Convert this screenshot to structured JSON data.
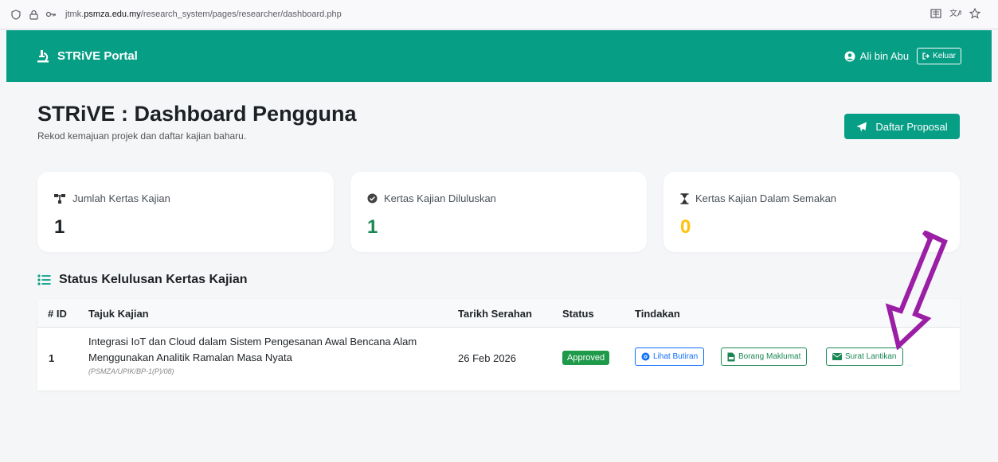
{
  "browser": {
    "url_prefix": "jtmk.",
    "url_domain": "psmza.edu.my",
    "url_path": "/research_system/pages/researcher/dashboard.php"
  },
  "navbar": {
    "brand": "STRiVE Portal",
    "user": "Ali bin Abu",
    "logout": "Keluar",
    "color": "#079e86"
  },
  "header": {
    "title": "STRiVE : Dashboard Pengguna",
    "subtitle": "Rekod kemajuan projek dan daftar kajian baharu.",
    "action": "Daftar Proposal"
  },
  "stats": [
    {
      "label": "Jumlah Kertas Kajian",
      "value": "1",
      "icon": "sitemap-icon",
      "color": "#1d2125"
    },
    {
      "label": "Kertas Kajian Diluluskan",
      "value": "1",
      "icon": "check-circle-icon",
      "color": "#198754"
    },
    {
      "label": "Kertas Kajian Dalam Semakan",
      "value": "0",
      "icon": "hourglass-icon",
      "color": "#ffc107"
    }
  ],
  "section": {
    "title": "Status Kelulusan Kertas Kajian"
  },
  "table": {
    "columns": [
      "# ID",
      "Tajuk Kajian",
      "Tarikh Serahan",
      "Status",
      "Tindakan"
    ],
    "rows": [
      {
        "id": "1",
        "title_line1": "Integrasi IoT dan Cloud dalam Sistem Pengesanan Awal Bencana Alam",
        "title_line2": "Menggunakan Analitik Ramalan Masa Nyata",
        "ref": "(PSMZA/UPIK/BP-1(P)/08)",
        "date": "26 Feb 2026",
        "status": "Approved",
        "actions": [
          "Lihat Butiran",
          "Borang Maklumat",
          "Surat Lantikan"
        ]
      }
    ]
  }
}
